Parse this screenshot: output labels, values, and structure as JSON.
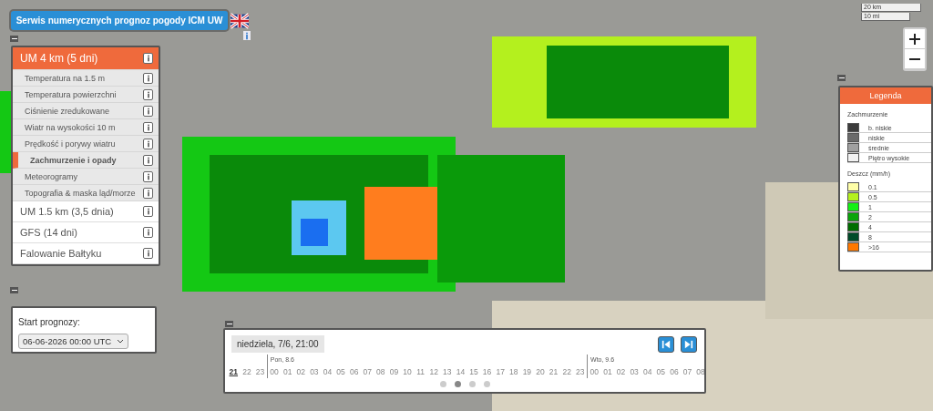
{
  "header": {
    "title": "Serwis numerycznych prognoz pogody ICM UW"
  },
  "models": [
    {
      "label": "UM 4 km (5 dni)",
      "selected": true,
      "children": [
        {
          "label": "Temperatura na 1.5 m",
          "selected": false
        },
        {
          "label": "Temperatura powierzchni",
          "selected": false
        },
        {
          "label": "Ciśnienie zredukowane",
          "selected": false
        },
        {
          "label": "Wiatr na wysokości 10 m",
          "selected": false
        },
        {
          "label": "Prędkość i porywy wiatru",
          "selected": false
        },
        {
          "label": "Zachmurzenie i opady",
          "selected": true
        },
        {
          "label": "Meteorogramy",
          "selected": false
        },
        {
          "label": "Topografia & maska ląd/morze",
          "selected": false
        }
      ]
    },
    {
      "label": "UM 1.5 km (3,5 dnia)",
      "selected": false
    },
    {
      "label": "GFS (14 dni)",
      "selected": false
    },
    {
      "label": "Falowanie Bałtyku",
      "selected": false
    }
  ],
  "start": {
    "label": "Start prognozy:",
    "value": "06-06-2026 00:00 UTC"
  },
  "scale": {
    "metric": "20 km",
    "imperial": "10 mi"
  },
  "legend": {
    "title": "Legenda",
    "sections": [
      {
        "title": "Zachmurzenie",
        "items": [
          {
            "label": "b. niskie",
            "color": "#3c3c3c"
          },
          {
            "label": "niskie",
            "color": "#6a6a6a"
          },
          {
            "label": "średnie",
            "color": "#a0a0a0"
          },
          {
            "label": "Piętro wysokie",
            "color": "#f2f2f2"
          }
        ]
      },
      {
        "title": "Deszcz (mm/h)",
        "items": [
          {
            "label": "0.1",
            "color": "#ffffa8"
          },
          {
            "label": "0.5",
            "color": "#b4f01e"
          },
          {
            "label": "1",
            "color": "#14f014"
          },
          {
            "label": "2",
            "color": "#0aa50a"
          },
          {
            "label": "4",
            "color": "#006e00"
          },
          {
            "label": "8",
            "color": "#004b28"
          },
          {
            "label": ">16",
            "color": "#ff7800"
          }
        ]
      }
    ]
  },
  "timeline": {
    "current": "niedziela, 7/6, 21:00",
    "days": [
      {
        "hours": [
          {
            "label": "21",
            "selected": true
          },
          {
            "label": "22",
            "selected": false
          },
          {
            "label": "23",
            "selected": false
          }
        ]
      },
      {
        "day_label": "Pon, 8.6",
        "hours": [
          {
            "label": "00",
            "selected": false
          },
          {
            "label": "01",
            "selected": false
          },
          {
            "label": "02",
            "selected": false
          },
          {
            "label": "03",
            "selected": false
          },
          {
            "label": "04",
            "selected": false
          },
          {
            "label": "05",
            "selected": false
          },
          {
            "label": "06",
            "selected": false
          },
          {
            "label": "07",
            "selected": false
          },
          {
            "label": "08",
            "selected": false
          },
          {
            "label": "09",
            "selected": false
          },
          {
            "label": "10",
            "selected": false
          },
          {
            "label": "11",
            "selected": false
          },
          {
            "label": "12",
            "selected": false
          },
          {
            "label": "13",
            "selected": false
          },
          {
            "label": "14",
            "selected": false
          },
          {
            "label": "15",
            "selected": false
          },
          {
            "label": "16",
            "selected": false
          },
          {
            "label": "17",
            "selected": false
          },
          {
            "label": "18",
            "selected": false
          },
          {
            "label": "19",
            "selected": false
          },
          {
            "label": "20",
            "selected": false
          },
          {
            "label": "21",
            "selected": false
          },
          {
            "label": "22",
            "selected": false
          },
          {
            "label": "23",
            "selected": false
          }
        ]
      },
      {
        "day_label": "Wto, 9.6",
        "hours": [
          {
            "label": "00",
            "selected": false
          },
          {
            "label": "01",
            "selected": false
          },
          {
            "label": "02",
            "selected": false
          },
          {
            "label": "03",
            "selected": false
          },
          {
            "label": "04",
            "selected": false
          },
          {
            "label": "05",
            "selected": false
          },
          {
            "label": "06",
            "selected": false
          },
          {
            "label": "07",
            "selected": false
          },
          {
            "label": "08",
            "selected": false
          }
        ]
      }
    ],
    "pages": [
      {
        "selected": false
      },
      {
        "selected": true
      },
      {
        "selected": false
      },
      {
        "selected": false
      }
    ]
  }
}
